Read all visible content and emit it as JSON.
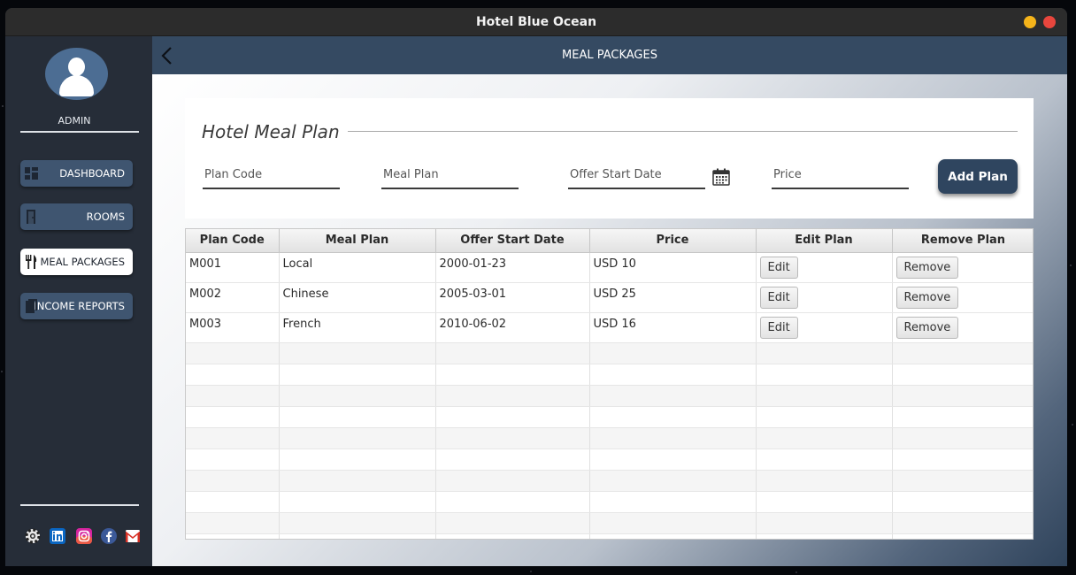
{
  "window": {
    "title": "Hotel Blue Ocean",
    "buttons": [
      "minimize",
      "close"
    ]
  },
  "sidebar": {
    "user_label": "ADMIN",
    "items": [
      {
        "label": "DASHBOARD",
        "icon": "dashboard-icon",
        "active": false
      },
      {
        "label": "ROOMS",
        "icon": "door-icon",
        "active": false
      },
      {
        "label": "MEAL PACKAGES",
        "icon": "fork-knife-icon",
        "active": true
      },
      {
        "label": "INCOME REPORTS",
        "icon": "document-icon",
        "active": false
      }
    ],
    "social": [
      "settings-icon",
      "linkedin-icon",
      "instagram-icon",
      "facebook-icon",
      "gmail-icon"
    ]
  },
  "header": {
    "title": "MEAL PACKAGES",
    "back_icon": "chevron-left-icon"
  },
  "form": {
    "title": "Hotel Meal Plan",
    "plan_code_placeholder": "Plan Code",
    "meal_plan_placeholder": "Meal Plan",
    "offer_start_date_placeholder": "Offer Start Date",
    "price_placeholder": "Price",
    "add_button": "Add Plan"
  },
  "table": {
    "columns": [
      "Plan Code",
      "Meal Plan",
      "Offer Start Date",
      "Price",
      "Edit Plan",
      "Remove Plan"
    ],
    "rows": [
      {
        "code": "M001",
        "meal": "Local",
        "date": "2000-01-23",
        "price": "USD 10",
        "edit": "Edit",
        "remove": "Remove"
      },
      {
        "code": "M002",
        "meal": "Chinese",
        "date": "2005-03-01",
        "price": "USD 25",
        "edit": "Edit",
        "remove": "Remove"
      },
      {
        "code": "M003",
        "meal": "French",
        "date": "2010-06-02",
        "price": "USD 16",
        "edit": "Edit",
        "remove": "Remove"
      }
    ]
  },
  "colors": {
    "sidebar_bg": "#262d38",
    "nav_button": "#3f5570",
    "header_bg": "#354a62",
    "accent_button": "#2f455f"
  }
}
